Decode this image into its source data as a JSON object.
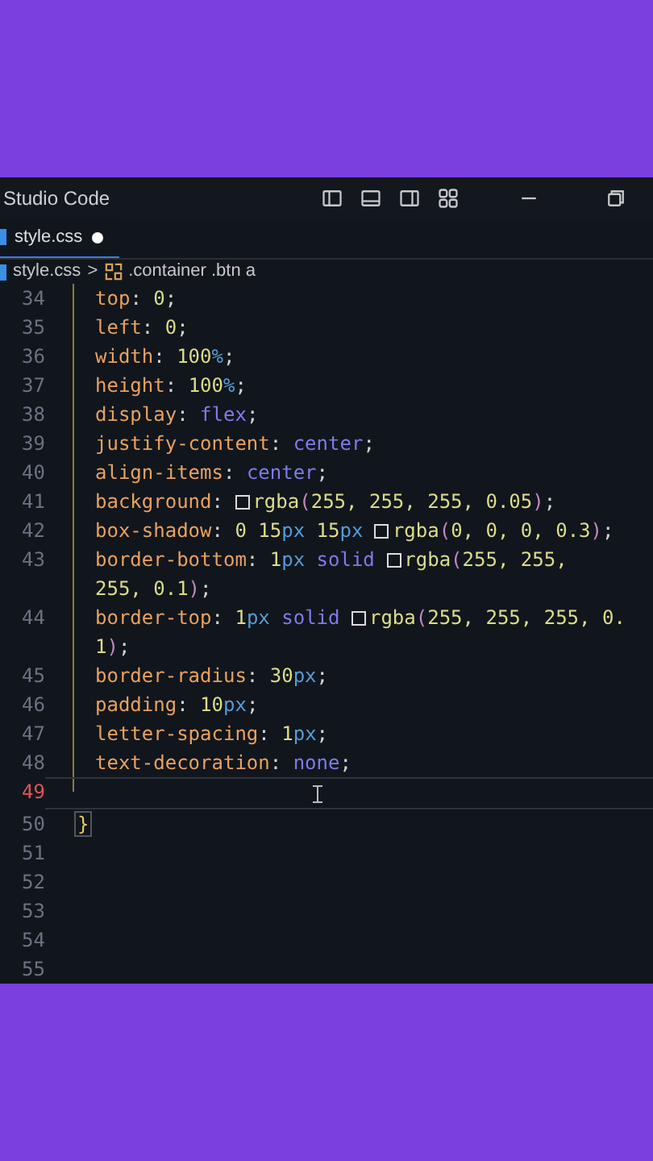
{
  "window": {
    "title": "Studio Code"
  },
  "tabs": [
    {
      "label": "style.css",
      "modified": true,
      "selected": true
    }
  ],
  "breadcrumb": {
    "file": "style.css",
    "separator": ">",
    "symbol": ".container .btn a"
  },
  "lines": [
    {
      "number": "34",
      "active": false,
      "rows": [
        [
          {
            "kind": "prop",
            "text": "top"
          },
          {
            "kind": "punct",
            "text": ": "
          },
          {
            "kind": "num",
            "text": "0"
          },
          {
            "kind": "punct",
            "text": ";"
          }
        ]
      ]
    },
    {
      "number": "35",
      "active": false,
      "rows": [
        [
          {
            "kind": "prop",
            "text": "left"
          },
          {
            "kind": "punct",
            "text": ": "
          },
          {
            "kind": "num",
            "text": "0"
          },
          {
            "kind": "punct",
            "text": ";"
          }
        ]
      ]
    },
    {
      "number": "36",
      "active": false,
      "rows": [
        [
          {
            "kind": "prop",
            "text": "width"
          },
          {
            "kind": "punct",
            "text": ": "
          },
          {
            "kind": "num",
            "text": "100"
          },
          {
            "kind": "unit",
            "text": "%"
          },
          {
            "kind": "punct",
            "text": ";"
          }
        ]
      ]
    },
    {
      "number": "37",
      "active": false,
      "rows": [
        [
          {
            "kind": "prop",
            "text": "height"
          },
          {
            "kind": "punct",
            "text": ": "
          },
          {
            "kind": "num",
            "text": "100"
          },
          {
            "kind": "unit",
            "text": "%"
          },
          {
            "kind": "punct",
            "text": ";"
          }
        ]
      ]
    },
    {
      "number": "38",
      "active": false,
      "rows": [
        [
          {
            "kind": "prop",
            "text": "display"
          },
          {
            "kind": "punct",
            "text": ": "
          },
          {
            "kind": "value",
            "text": "flex"
          },
          {
            "kind": "punct",
            "text": ";"
          }
        ]
      ]
    },
    {
      "number": "39",
      "active": false,
      "rows": [
        [
          {
            "kind": "prop",
            "text": "justify-content"
          },
          {
            "kind": "punct",
            "text": ": "
          },
          {
            "kind": "value",
            "text": "center"
          },
          {
            "kind": "punct",
            "text": ";"
          }
        ]
      ]
    },
    {
      "number": "40",
      "active": false,
      "rows": [
        [
          {
            "kind": "prop",
            "text": "align-items"
          },
          {
            "kind": "punct",
            "text": ": "
          },
          {
            "kind": "value",
            "text": "center"
          },
          {
            "kind": "punct",
            "text": ";"
          }
        ]
      ]
    },
    {
      "number": "41",
      "active": false,
      "rows": [
        [
          {
            "kind": "prop",
            "text": "background"
          },
          {
            "kind": "punct",
            "text": ": "
          },
          {
            "kind": "swatch"
          },
          {
            "kind": "func",
            "text": "rgba"
          },
          {
            "kind": "paren",
            "text": "("
          },
          {
            "kind": "num",
            "text": "255, 255, 255, 0.05"
          },
          {
            "kind": "paren",
            "text": ")"
          },
          {
            "kind": "punct",
            "text": ";"
          }
        ]
      ]
    },
    {
      "number": "42",
      "active": false,
      "rows": [
        [
          {
            "kind": "prop",
            "text": "box-shadow"
          },
          {
            "kind": "punct",
            "text": ": "
          },
          {
            "kind": "num",
            "text": "0 15"
          },
          {
            "kind": "unit",
            "text": "px"
          },
          {
            "kind": "num",
            "text": " 15"
          },
          {
            "kind": "unit",
            "text": "px "
          },
          {
            "kind": "swatch"
          },
          {
            "kind": "func",
            "text": "rgba"
          },
          {
            "kind": "paren",
            "text": "("
          },
          {
            "kind": "num",
            "text": "0, 0, 0, 0.3"
          },
          {
            "kind": "paren",
            "text": ")"
          },
          {
            "kind": "punct",
            "text": ";"
          }
        ]
      ]
    },
    {
      "number": "43",
      "active": false,
      "rows": [
        [
          {
            "kind": "prop",
            "text": "border-bottom"
          },
          {
            "kind": "punct",
            "text": ": "
          },
          {
            "kind": "num",
            "text": "1"
          },
          {
            "kind": "unit",
            "text": "px"
          },
          {
            "kind": "value",
            "text": " solid "
          },
          {
            "kind": "swatch"
          },
          {
            "kind": "func",
            "text": "rgba"
          },
          {
            "kind": "paren",
            "text": "("
          },
          {
            "kind": "num",
            "text": "255, 255,"
          },
          {
            "kind": "break"
          },
          {
            "kind": "num",
            "text": "255, 0.1"
          },
          {
            "kind": "paren",
            "text": ")"
          },
          {
            "kind": "punct",
            "text": ";"
          }
        ]
      ]
    },
    {
      "number": "44",
      "active": false,
      "rows": [
        [
          {
            "kind": "prop",
            "text": "border-top"
          },
          {
            "kind": "punct",
            "text": ": "
          },
          {
            "kind": "num",
            "text": "1"
          },
          {
            "kind": "unit",
            "text": "px"
          },
          {
            "kind": "value",
            "text": " solid "
          },
          {
            "kind": "swatch"
          },
          {
            "kind": "func",
            "text": "rgba"
          },
          {
            "kind": "paren",
            "text": "("
          },
          {
            "kind": "num",
            "text": "255, 255, 255, 0."
          },
          {
            "kind": "break"
          },
          {
            "kind": "num",
            "text": "1"
          },
          {
            "kind": "paren",
            "text": ")"
          },
          {
            "kind": "punct",
            "text": ";"
          }
        ]
      ]
    },
    {
      "number": "45",
      "active": false,
      "rows": [
        [
          {
            "kind": "prop",
            "text": "border-radius"
          },
          {
            "kind": "punct",
            "text": ": "
          },
          {
            "kind": "num",
            "text": "30"
          },
          {
            "kind": "unit",
            "text": "px"
          },
          {
            "kind": "punct",
            "text": ";"
          }
        ]
      ]
    },
    {
      "number": "46",
      "active": false,
      "rows": [
        [
          {
            "kind": "prop",
            "text": "padding"
          },
          {
            "kind": "punct",
            "text": ": "
          },
          {
            "kind": "num",
            "text": "10"
          },
          {
            "kind": "unit",
            "text": "px"
          },
          {
            "kind": "punct",
            "text": ";"
          }
        ]
      ]
    },
    {
      "number": "47",
      "active": false,
      "rows": [
        [
          {
            "kind": "prop",
            "text": "letter-spacing"
          },
          {
            "kind": "punct",
            "text": ": "
          },
          {
            "kind": "num",
            "text": "1"
          },
          {
            "kind": "unit",
            "text": "px"
          },
          {
            "kind": "punct",
            "text": ";"
          }
        ]
      ]
    },
    {
      "number": "48",
      "active": false,
      "rows": [
        [
          {
            "kind": "prop",
            "text": "text-decoration"
          },
          {
            "kind": "punct",
            "text": ": "
          },
          {
            "kind": "value",
            "text": "none"
          },
          {
            "kind": "punct",
            "text": ";"
          }
        ]
      ]
    },
    {
      "number": "49",
      "active": true,
      "rows": [
        []
      ]
    },
    {
      "number": "50",
      "active": false,
      "outdent": true,
      "rows": [
        [
          {
            "kind": "brace",
            "text": "}"
          }
        ]
      ]
    },
    {
      "number": "51",
      "active": false,
      "rows": [
        []
      ]
    },
    {
      "number": "52",
      "active": false,
      "rows": [
        []
      ]
    },
    {
      "number": "53",
      "active": false,
      "rows": [
        []
      ]
    },
    {
      "number": "54",
      "active": false,
      "rows": [
        []
      ]
    },
    {
      "number": "55",
      "active": false,
      "rows": [
        []
      ]
    }
  ]
}
